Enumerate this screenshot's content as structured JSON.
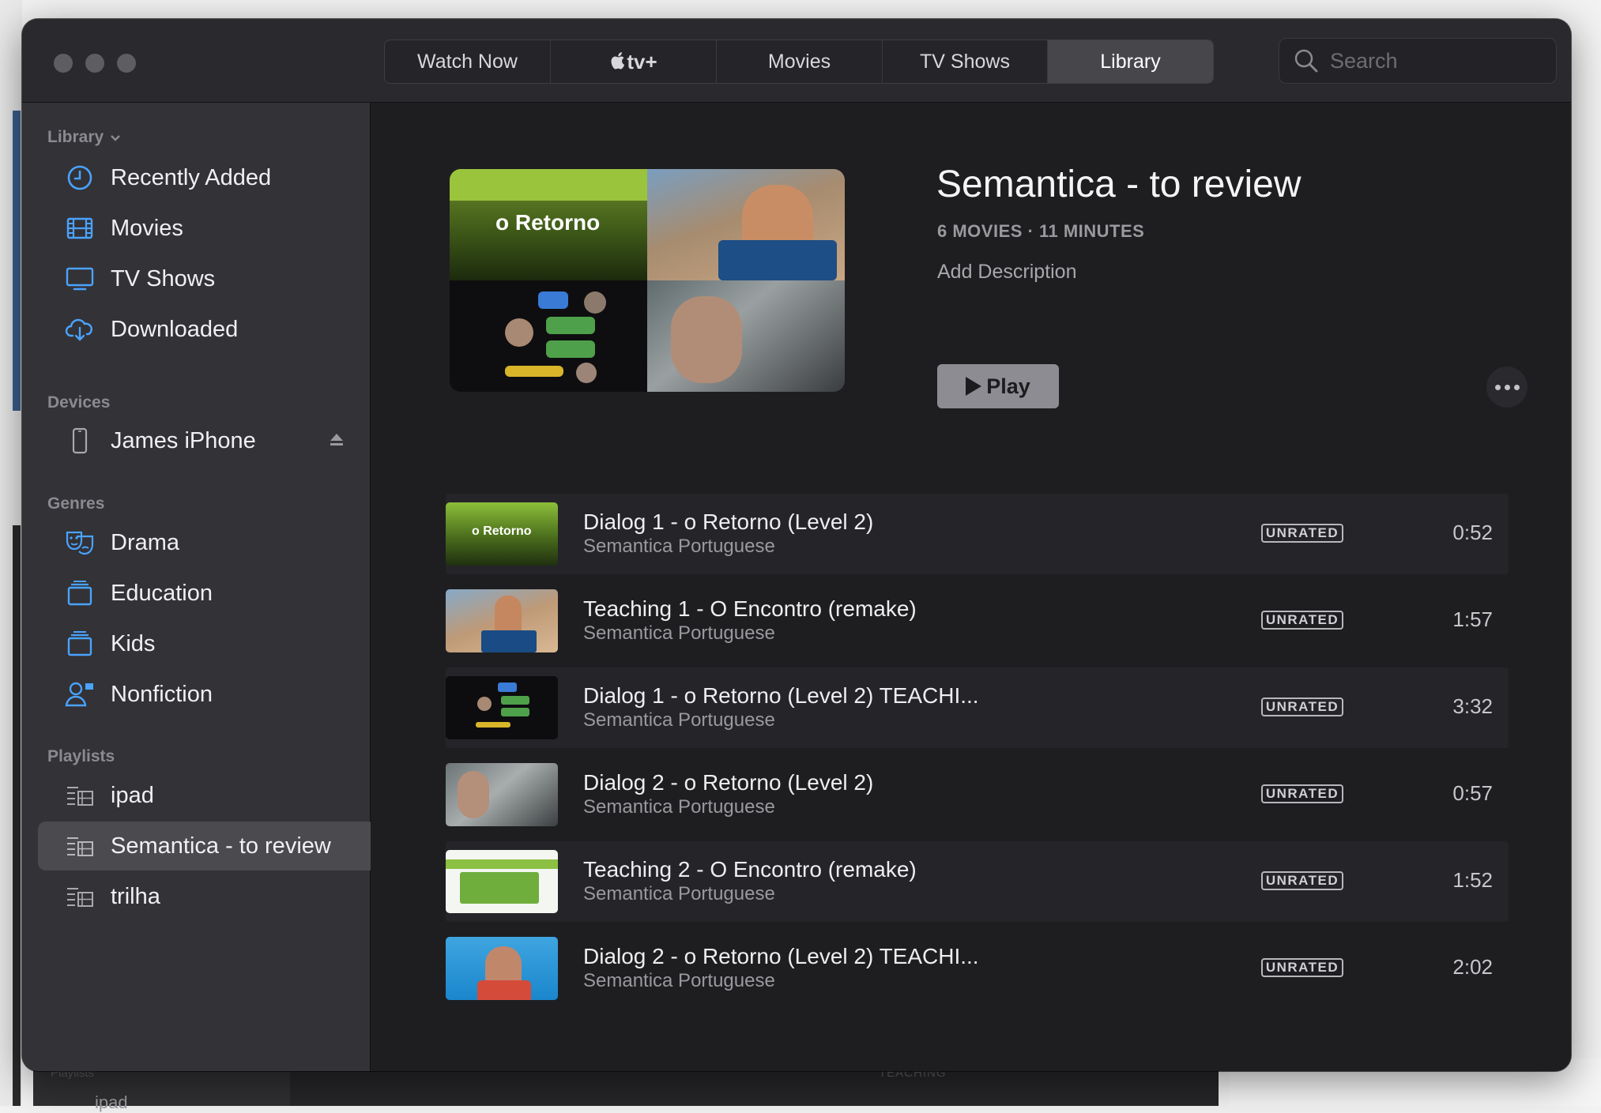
{
  "window": {
    "tabs": [
      {
        "label": "Watch Now",
        "active": false
      },
      {
        "label": "tv+",
        "active": false,
        "prefix": ""
      },
      {
        "label": "Movies",
        "active": false
      },
      {
        "label": "TV Shows",
        "active": false
      },
      {
        "label": "Library",
        "active": true
      }
    ],
    "search_placeholder": "Search"
  },
  "sidebar": {
    "library_header": "Library",
    "library_items": [
      {
        "label": "Recently Added",
        "icon": "clock-icon"
      },
      {
        "label": "Movies",
        "icon": "film-icon"
      },
      {
        "label": "TV Shows",
        "icon": "tv-icon"
      },
      {
        "label": "Downloaded",
        "icon": "cloud-download-icon"
      }
    ],
    "devices_header": "Devices",
    "device": {
      "label": "James iPhone",
      "icon": "iphone-icon"
    },
    "genres_header": "Genres",
    "genre_items": [
      {
        "label": "Drama",
        "icon": "masks-icon"
      },
      {
        "label": "Education",
        "icon": "stack-icon"
      },
      {
        "label": "Kids",
        "icon": "stack-icon"
      },
      {
        "label": "Nonfiction",
        "icon": "person-icon"
      }
    ],
    "playlists_header": "Playlists",
    "playlist_items": [
      {
        "label": "ipad",
        "selected": false
      },
      {
        "label": "Semantica - to review",
        "selected": true
      },
      {
        "label": "trilha",
        "selected": false
      }
    ]
  },
  "playlist": {
    "title": "Semantica - to review",
    "meta": "6 MOVIES · 11 MINUTES",
    "description_placeholder": "Add Description",
    "play_label": "Play",
    "art_title": "o Retorno"
  },
  "items": [
    {
      "title": "Dialog 1 - o Retorno (Level 2)",
      "subtitle": "Semantica Portuguese",
      "rating": "UNRATED",
      "duration": "0:52",
      "thumb_text": "o Retorno"
    },
    {
      "title": "Teaching 1 - O Encontro (remake)",
      "subtitle": "Semantica Portuguese",
      "rating": "UNRATED",
      "duration": "1:57"
    },
    {
      "title": "Dialog 1 - o Retorno (Level 2) TEACHI...",
      "subtitle": "Semantica Portuguese",
      "rating": "UNRATED",
      "duration": "3:32"
    },
    {
      "title": "Dialog 2 - o Retorno (Level 2)",
      "subtitle": "Semantica Portuguese",
      "rating": "UNRATED",
      "duration": "0:57"
    },
    {
      "title": "Teaching 2 - O Encontro (remake)",
      "subtitle": "Semantica Portuguese",
      "rating": "UNRATED",
      "duration": "1:52"
    },
    {
      "title": "Dialog 2 - o Retorno (Level 2) TEACHI...",
      "subtitle": "Semantica Portuguese",
      "rating": "UNRATED",
      "duration": "2:02"
    }
  ],
  "background": {
    "bottom_header": "Playlists",
    "bottom_item": "ipad",
    "bottom_center": "TEACHING"
  },
  "colors": {
    "window_bg": "#1e1e21",
    "sidebar_bg": "#333236",
    "sidebar_icon": "#4aa3ff",
    "selected_bg": "#4b4a4f"
  }
}
